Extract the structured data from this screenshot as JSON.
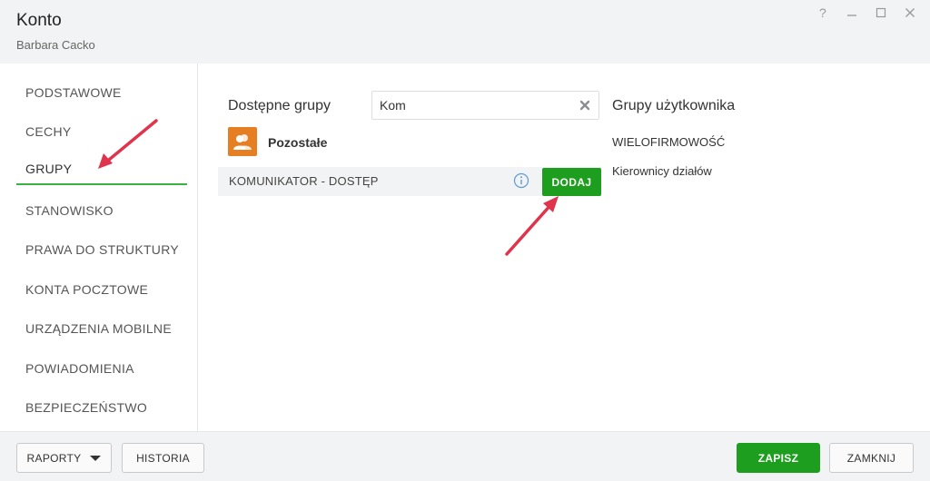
{
  "window": {
    "title": "Konto",
    "subtitle": "Barbara Cacko",
    "controls": [
      "help-icon",
      "minimize-icon",
      "maximize-icon",
      "close-icon"
    ]
  },
  "sidebar": {
    "items": [
      {
        "label": "PODSTAWOWE",
        "active": false
      },
      {
        "label": "CECHY",
        "active": false
      },
      {
        "label": "GRUPY",
        "active": true
      },
      {
        "label": "STANOWISKO",
        "active": false
      },
      {
        "label": "PRAWA DO STRUKTURY",
        "active": false
      },
      {
        "label": "KONTA POCZTOWE",
        "active": false
      },
      {
        "label": "URZĄDZENIA MOBILNE",
        "active": false
      },
      {
        "label": "POWIADOMIENIA",
        "active": false
      },
      {
        "label": "BEZPIECZEŃSTWO",
        "active": false
      }
    ]
  },
  "main": {
    "available_label": "Dostępne grupy",
    "search": {
      "value": "Kom"
    },
    "group_category": "Pozostałe",
    "available_groups": [
      {
        "label": "KOMUNIKATOR - DOSTĘP",
        "add_label": "DODAJ"
      }
    ],
    "user_groups_label": "Grupy użytkownika",
    "user_groups": [
      "WIELOFIRMOWOŚĆ",
      "Kierownicy działów"
    ]
  },
  "footer": {
    "reports_label": "RAPORTY",
    "history_label": "HISTORIA",
    "save_label": "ZAPISZ",
    "close_label": "ZAMKNIJ"
  },
  "colors": {
    "accent_green": "#1e9e1e",
    "active_underline": "#3cb043",
    "group_icon_bg": "#e67e22",
    "annotation_arrow": "#e0344d"
  }
}
